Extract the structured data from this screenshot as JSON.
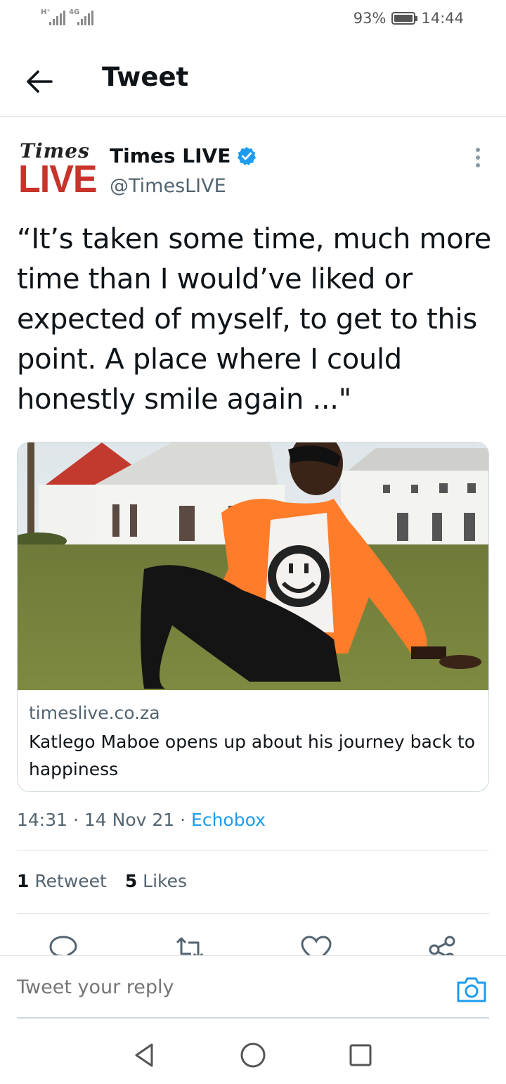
{
  "status_bar": {
    "signal1_label": "H⁺",
    "signal2_label": "4G",
    "battery": "93%",
    "time": "14:44"
  },
  "header": {
    "title": "Tweet"
  },
  "author": {
    "logo_top": "Times",
    "logo_bottom": "LIVE",
    "name": "Times LIVE",
    "handle": "@TimesLIVE",
    "verified": true
  },
  "tweet": {
    "text": "“It’s taken some time, much more time than I would’ve liked or expected of myself, to get to this point. A place where I could honestly smile again ...\""
  },
  "card": {
    "domain": "timeslive.co.za",
    "title": "Katlego Maboe opens up about his journey back to happiness"
  },
  "meta": {
    "time": "14:31",
    "date": "14 Nov 21",
    "source": "Echobox",
    "separator": " · "
  },
  "stats": {
    "retweets_count": "1",
    "retweets_label": "Retweet",
    "likes_count": "5",
    "likes_label": "Likes"
  },
  "reply": {
    "placeholder": "Tweet your reply"
  },
  "icons": {
    "back": "arrow-left-icon",
    "verified": "verified-badge-icon",
    "more": "more-vertical-icon",
    "reply": "comment-icon",
    "retweet": "retweet-icon",
    "like": "heart-icon",
    "share": "share-icon",
    "camera": "camera-icon",
    "nav_back": "triangle-back-icon",
    "nav_home": "circle-home-icon",
    "nav_recents": "square-recents-icon"
  },
  "colors": {
    "accent": "#1d9bf0",
    "text": "#0f1419",
    "secondary": "#536471",
    "logo_red": "#c8342b"
  }
}
